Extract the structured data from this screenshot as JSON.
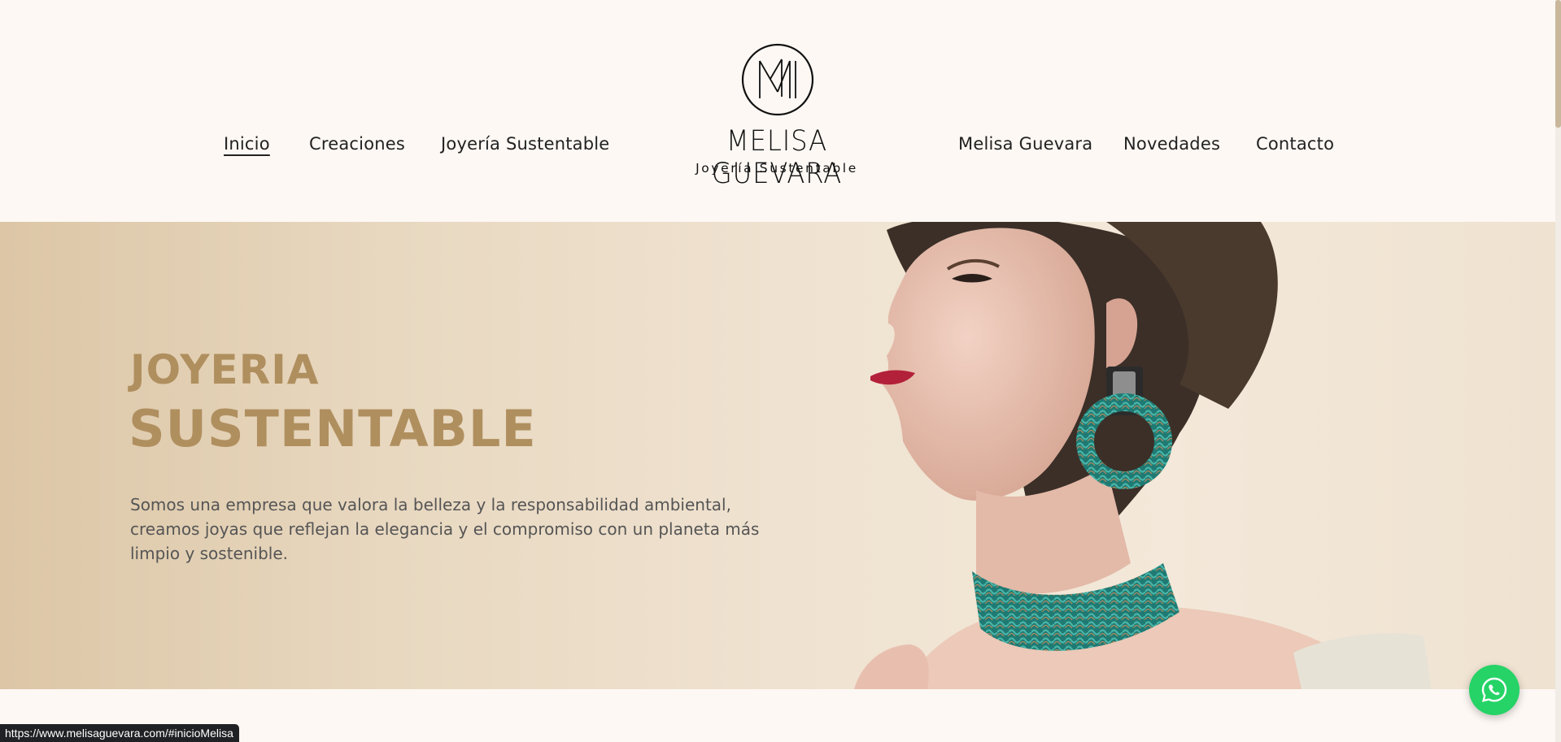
{
  "nav_left": [
    {
      "label": "Inicio",
      "active": true
    },
    {
      "label": "Creaciones"
    },
    {
      "label": "Joyería Sustentable"
    }
  ],
  "nav_right": [
    {
      "label": "Melisa Guevara"
    },
    {
      "label": "Novedades"
    },
    {
      "label": "Contacto"
    }
  ],
  "logo": {
    "name": "MELISA GUEVARA",
    "tagline": "Joyería  Sustentable"
  },
  "hero": {
    "title_line1": "JOYERIA",
    "title_line2": "SUSTENTABLE",
    "description": "Somos una empresa que valora la belleza y la responsabilidad ambiental, creamos joyas que reflejan la elegancia y el compromiso con un planeta más limpio y sostenible."
  },
  "whatsapp": {
    "icon": "whatsapp-icon"
  },
  "status_bar": {
    "url": "https://www.melisaguevara.com/#inicioMelisa"
  },
  "colors": {
    "page_bg": "#fdf8f4",
    "hero_title": "#b08f5f",
    "hero_text": "#555555",
    "whatsapp": "#25d366"
  }
}
